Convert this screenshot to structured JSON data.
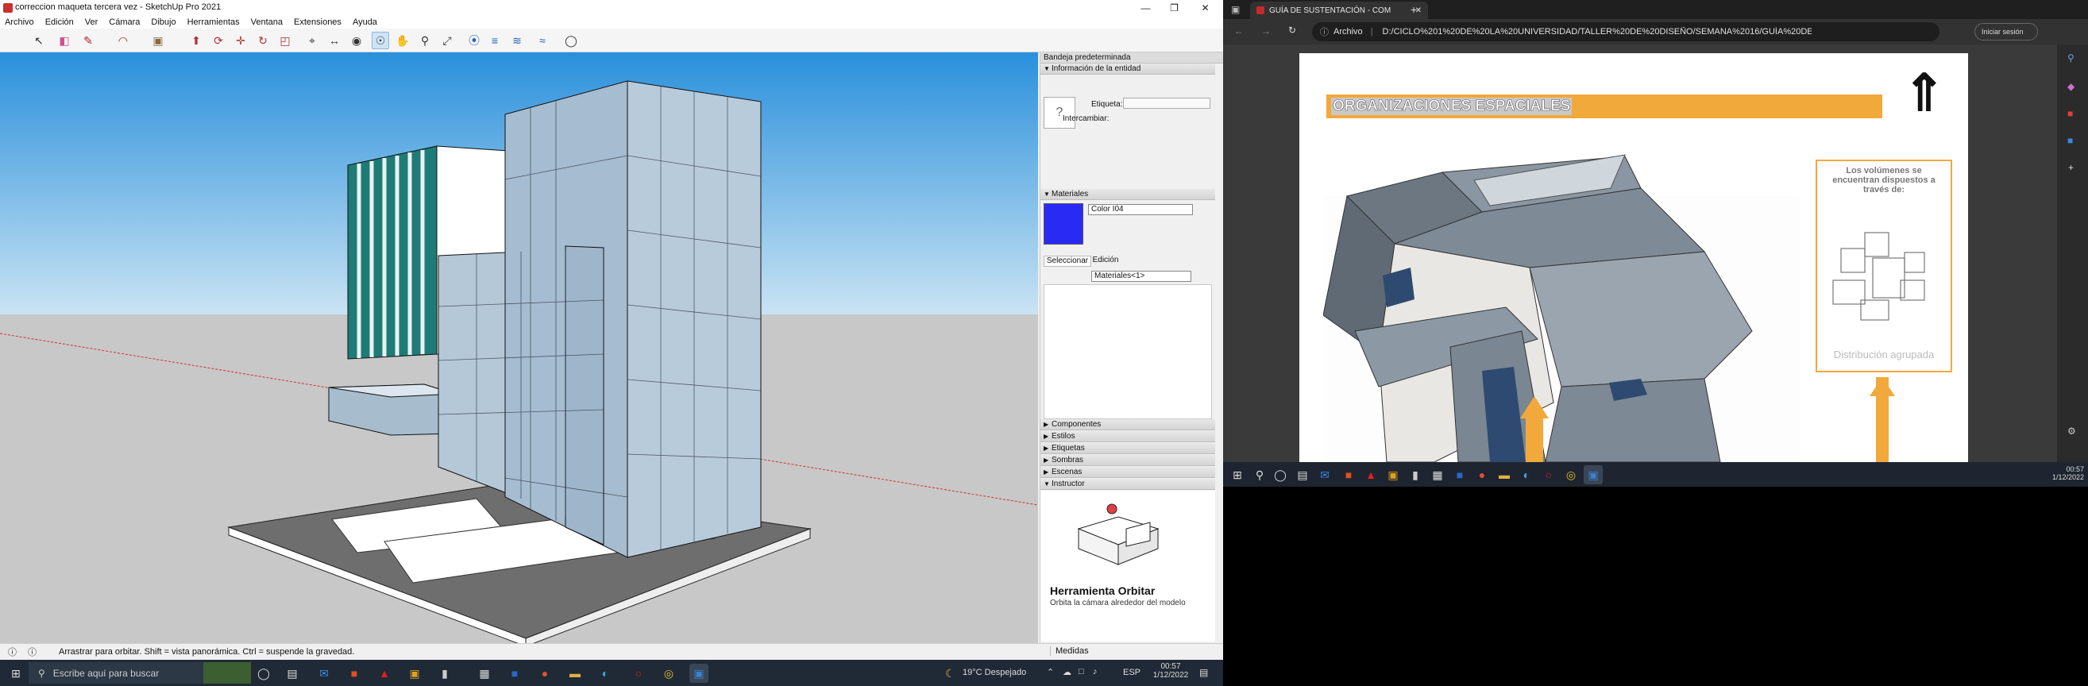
{
  "sketchup": {
    "title": "correccion maqueta tercera vez - SketchUp Pro 2021",
    "menu": [
      "Archivo",
      "Edición",
      "Ver",
      "Cámara",
      "Dibujo",
      "Herramientas",
      "Ventana",
      "Extensiones",
      "Ayuda"
    ],
    "tray": {
      "title": "Bandeja predeterminada",
      "entity_section": "Información de la entidad",
      "etiqueta_label": "Etiqueta:",
      "intercambiar_label": "Intercambiar:",
      "unknown_glyph": "?",
      "materials_section": "Materiales",
      "material_name": "Color I04",
      "material_color": "#2a2af5",
      "tab_select": "Seleccionar",
      "tab_edit": "Edición",
      "materials_dropdown": "Materiales<1>",
      "sections": [
        "Componentes",
        "Estilos",
        "Etiquetas",
        "Sombras",
        "Escenas",
        "Instructor"
      ],
      "instructor_title": "Herramienta Orbitar",
      "instructor_text": "Orbita la cámara alrededor del modelo"
    },
    "status_text": "Arrastrar para orbitar. Shift = vista panorámica. Ctrl = suspende la gravedad.",
    "measure_label": "Medidas"
  },
  "edge": {
    "tab_title": "GUÍA DE SUSTENTACIÓN - COM",
    "archivo_label": "Archivo",
    "url": "D:/CICLO%201%20DE%20LA%20UNIVERSIDAD/TALLER%20DE%20DISEÑO/SEMANA%2016/GUÍA%20DE%...",
    "sign_in": "Iniciar sesión",
    "pdf": {
      "heading": "ORGANIZACIONES ESPACIALES",
      "side_text": "Los volúmenes se encuentran dispuestos a través de:",
      "caption": "Distribución agrupada"
    }
  },
  "taskbar_main": {
    "search_placeholder": "Escribe aquí para buscar",
    "weather": "19°C  Despejado",
    "lang": "ESP",
    "time": "00:57",
    "date": "1/12/2022"
  },
  "taskbar_right": {
    "time": "00:57",
    "date": "1/12/2022"
  },
  "colors": {
    "sky": "#3b9ee3",
    "ground": "#c8c8c8",
    "glass": "#b2c7d9",
    "accent_orange": "#f2a93b"
  }
}
